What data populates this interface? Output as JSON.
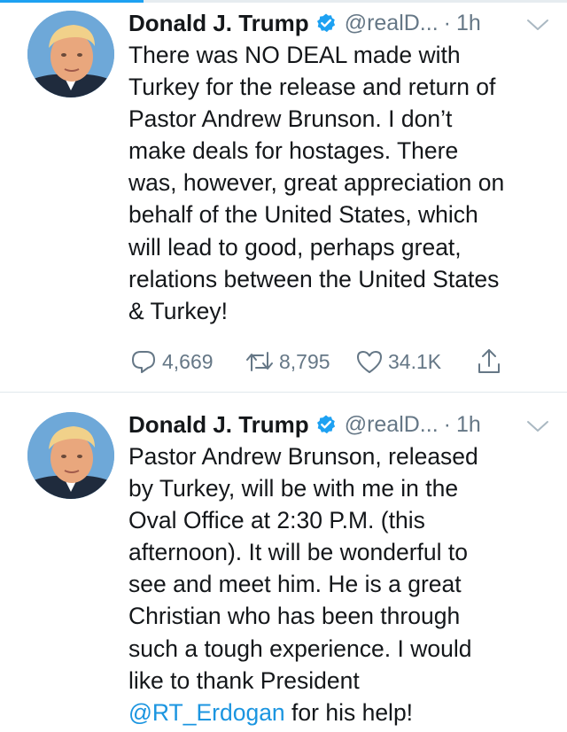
{
  "tweets": [
    {
      "author": "Donald J. Trump",
      "handle": "@realD...",
      "separator": "·",
      "time": "1h",
      "text_lines": [
        "There was NO DEAL made with",
        "Turkey for the release and return of",
        "Pastor Andrew Brunson. I don’t",
        "make deals for hostages. There",
        "was, however, great appreciation on",
        "behalf of the United States, which",
        "will lead to good, perhaps great,",
        "relations between the United States",
        "& Turkey!"
      ],
      "replies": "4,669",
      "retweets": "8,795",
      "likes": "34.1K"
    },
    {
      "author": "Donald J. Trump",
      "handle": "@realD...",
      "separator": "·",
      "time": "1h",
      "text_lines": [
        "Pastor Andrew Brunson, released",
        "by Turkey, will be with me in the",
        "Oval Office at 2:30 P.M. (this",
        "afternoon). It will be wonderful to",
        "see and meet him. He is a great",
        "Christian who has been through",
        "such a tough experience. I would",
        "like to thank President"
      ],
      "last_line_mention": "@RT_Erdogan",
      "last_line_rest": " for his help!"
    }
  ],
  "icons": {
    "avatar": "avatar",
    "verified": "verified-badge-icon",
    "menu": "chevron-down-icon",
    "reply": "reply-icon",
    "retweet": "retweet-icon",
    "like": "heart-icon",
    "share": "share-icon"
  },
  "colors": {
    "verified": "#1da1f2",
    "mention": "#1b95e0",
    "muted": "#657786"
  }
}
